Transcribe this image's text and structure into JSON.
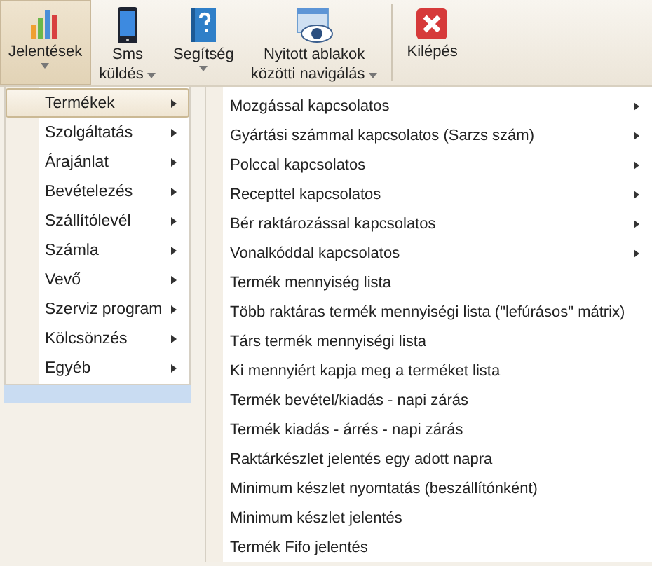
{
  "toolbar": {
    "buttons": [
      {
        "kind": "chart",
        "lines": [
          "Jelentések"
        ],
        "dropdown": true,
        "selected": true
      },
      {
        "kind": "phone",
        "lines": [
          "Sms",
          "küldés"
        ],
        "dropdown": true,
        "selected": false
      },
      {
        "kind": "help",
        "lines": [
          "Segítség"
        ],
        "dropdown": true,
        "selected": false
      },
      {
        "kind": "window",
        "lines": [
          "Nyitott ablakok",
          "közötti navigálás"
        ],
        "dropdown": true,
        "selected": false
      },
      {
        "kind": "exit",
        "lines": [
          "Kilépés"
        ],
        "dropdown": false,
        "selected": false
      }
    ]
  },
  "menu": {
    "items": [
      {
        "label": "Termékek",
        "submenu": true,
        "selected": true
      },
      {
        "label": "Szolgáltatás",
        "submenu": true,
        "selected": false
      },
      {
        "label": "Árajánlat",
        "submenu": true,
        "selected": false
      },
      {
        "label": "Bevételezés",
        "submenu": true,
        "selected": false
      },
      {
        "label": "Szállítólevél",
        "submenu": true,
        "selected": false
      },
      {
        "label": "Számla",
        "submenu": true,
        "selected": false
      },
      {
        "label": "Vevő",
        "submenu": true,
        "selected": false
      },
      {
        "label": "Szerviz program",
        "submenu": true,
        "selected": false
      },
      {
        "label": "Kölcsönzés",
        "submenu": true,
        "selected": false
      },
      {
        "label": "Egyéb",
        "submenu": true,
        "selected": false
      }
    ]
  },
  "submenu": {
    "items": [
      {
        "label": "Mozgással kapcsolatos",
        "submenu": true
      },
      {
        "label": "Gyártási számmal kapcsolatos (Sarzs szám)",
        "submenu": true
      },
      {
        "label": "Polccal kapcsolatos",
        "submenu": true
      },
      {
        "label": "Recepttel kapcsolatos",
        "submenu": true
      },
      {
        "label": "Bér raktározással kapcsolatos",
        "submenu": true
      },
      {
        "label": "Vonalkóddal kapcsolatos",
        "submenu": true
      },
      {
        "label": "Termék mennyiség lista",
        "submenu": false
      },
      {
        "label": "Több raktáras termék mennyiségi lista (\"lefúrásos\" mátrix)",
        "submenu": false
      },
      {
        "label": "Társ termék mennyiségi lista",
        "submenu": false
      },
      {
        "label": "Ki mennyiért kapja meg a terméket lista",
        "submenu": false
      },
      {
        "label": "Termék bevétel/kiadás - napi zárás",
        "submenu": false
      },
      {
        "label": "Termék kiadás - árrés - napi zárás",
        "submenu": false
      },
      {
        "label": "Raktárkészlet jelentés egy adott napra",
        "submenu": false
      },
      {
        "label": "Minimum készlet nyomtatás (beszállítónként)",
        "submenu": false
      },
      {
        "label": "Minimum készlet jelentés",
        "submenu": false
      },
      {
        "label": "Termék Fifo jelentés",
        "submenu": false
      }
    ]
  }
}
